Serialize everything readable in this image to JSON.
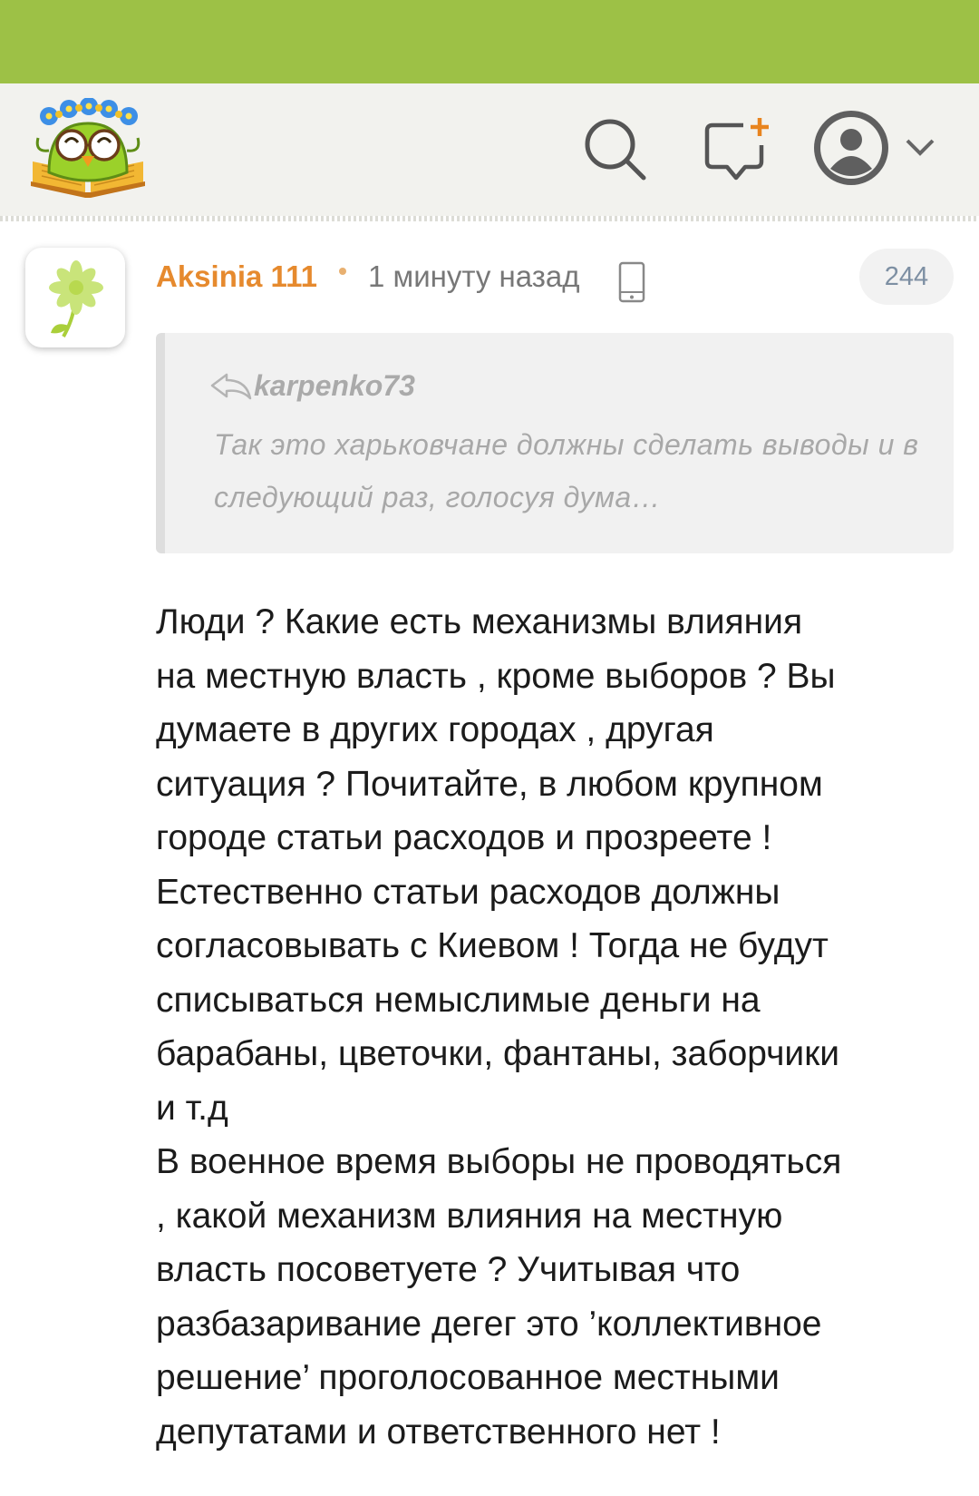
{
  "header": {
    "logo_icon": "owl-on-book-logo",
    "search_icon": "search-icon",
    "new_post_icon": "new-message-plus-icon",
    "profile_icon": "user-avatar-icon",
    "profile_menu_icon": "chevron-down-icon"
  },
  "comment": {
    "author": "Aksinia 111",
    "timestamp": "1 минуту назад",
    "device_icon": "mobile-phone-icon",
    "count": "244",
    "avatar_icon": "daisy-flower-avatar",
    "quote": {
      "reply_icon": "reply-arrow-icon",
      "author": "karpenko73",
      "text": "Так это харьковчане должны сделать выводы и в следующий раз, голосуя дума…"
    },
    "text": "Люди ? Какие есть механизмы влияния\nна местную власть , кроме выборов ? Вы\nдумаете в других городах , другая\nситуация ? Почитайте, в любом крупном\nгороде статьи расходов и прозреете !\nЕстественно статьи расходов должны\nсогласовывать с Киевом ! Тогда не будут\nсписываться немыслимые деньги на\nбарабаны, цветочки, фантаны, заборчики\nи т.д\nВ военное время выборы не проводяться\n, какой механизм влияния на местную\nвласть посоветуете ? Учитывая что\nразбазаривание дегег это ’коллективное\nрешение’ проголосованное местными\nдепутатами и ответственного нет !"
  },
  "colors": {
    "status_bar": "#9dc146",
    "header_bg": "#f2f2ee",
    "author": "#e68a2e",
    "quote_bg": "#f1f1f1",
    "badge_text": "#7d8fa3"
  }
}
